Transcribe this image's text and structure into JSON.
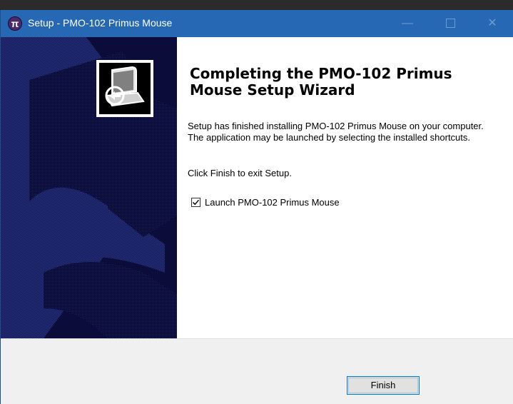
{
  "window": {
    "title": "Setup - PMO-102 Primus Mouse",
    "app_icon_glyph": "π",
    "controls": [
      "minimize-icon",
      "maximize-icon",
      "close-icon"
    ]
  },
  "wizard": {
    "heading": "Completing the PMO-102 Primus Mouse Setup Wizard",
    "finished_text": "Setup has finished installing PMO-102 Primus Mouse on your computer. The application may be launched by selecting the installed shortcuts.",
    "exit_text": "Click Finish to exit Setup.",
    "launch_checkbox": {
      "label": "Launch PMO-102 Primus Mouse",
      "checked": true
    }
  },
  "footer": {
    "finish_label": "Finish"
  },
  "colors": {
    "titlebar": "#2668b3",
    "banner_dark": "#0c0c3a",
    "banner_light": "#2b3a8a",
    "footer_bg": "#f0f0f0",
    "button_border": "#0078d7"
  }
}
